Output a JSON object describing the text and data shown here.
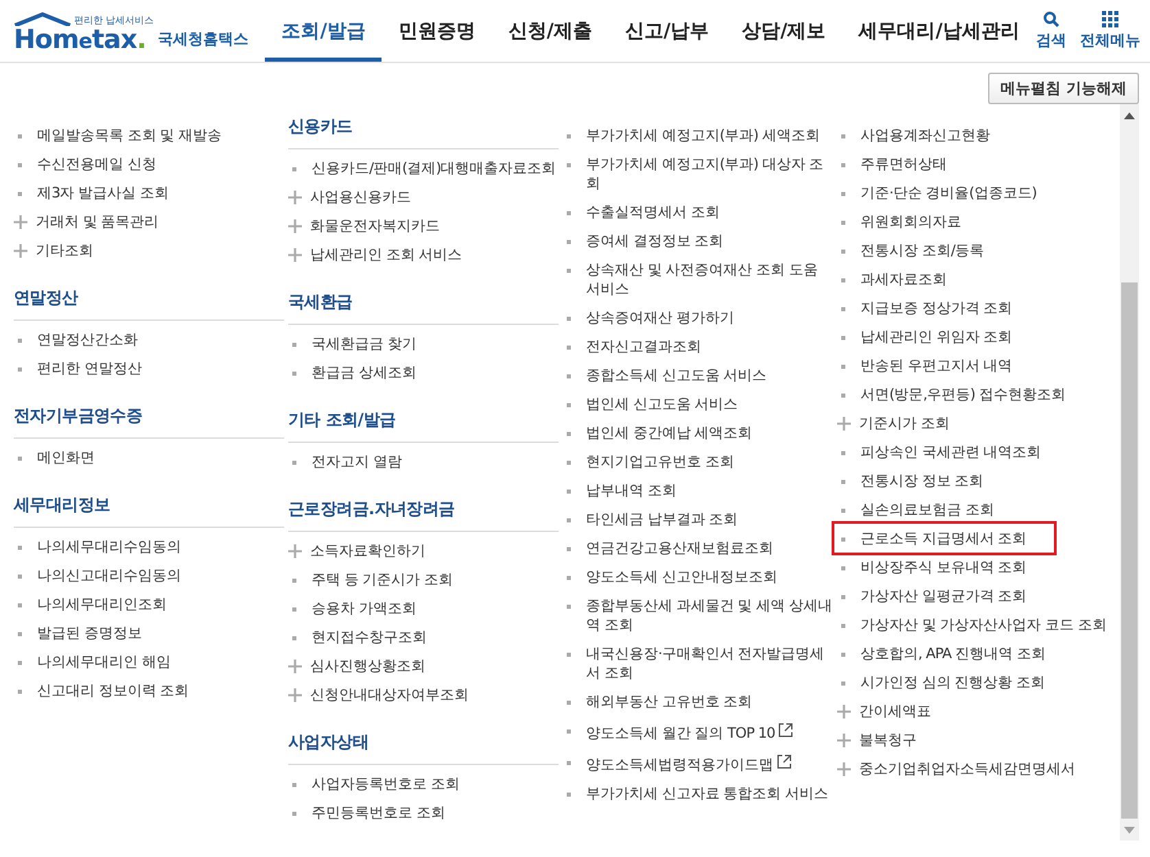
{
  "header": {
    "logo": {
      "tagline": "편리한 납세서비스",
      "name_start": "Hom",
      "name_mark": "e",
      "name_end": "tax",
      "dot": ".",
      "subtitle": "국세청홈택스"
    },
    "tabs": [
      {
        "label": "조회/발급",
        "selected": true
      },
      {
        "label": "민원증명",
        "selected": false
      },
      {
        "label": "신청/제출",
        "selected": false
      },
      {
        "label": "신고/납부",
        "selected": false
      },
      {
        "label": "상담/제보",
        "selected": false
      },
      {
        "label": "세무대리/납세관리",
        "selected": false
      }
    ],
    "actions": [
      {
        "kind": "search",
        "label": "검색"
      },
      {
        "kind": "menu",
        "label": "전체메뉴"
      }
    ]
  },
  "toggle_button": "메뉴펼침 기능해제",
  "columns": [
    {
      "sections": [
        {
          "items": [
            {
              "label": "메일발송목록 조회 및 재발송",
              "kind": "bullet",
              "highlighted": false
            },
            {
              "label": "수신전용메일 신청",
              "kind": "bullet",
              "highlighted": false
            },
            {
              "label": "제3자 발급사실 조회",
              "kind": "bullet",
              "highlighted": false
            },
            {
              "label": "거래처 및 품목관리",
              "kind": "plus",
              "highlighted": false
            },
            {
              "label": "기타조회",
              "kind": "plus",
              "highlighted": false
            }
          ]
        },
        {
          "heading": "연말정산",
          "items": [
            {
              "label": "연말정산간소화",
              "kind": "bullet",
              "highlighted": false
            },
            {
              "label": "편리한 연말정산",
              "kind": "bullet",
              "highlighted": false
            }
          ]
        },
        {
          "heading": "전자기부금영수증",
          "items": [
            {
              "label": "메인화면",
              "kind": "bullet",
              "highlighted": false
            }
          ]
        },
        {
          "heading": "세무대리정보",
          "items": [
            {
              "label": "나의세무대리수임동의",
              "kind": "bullet",
              "highlighted": false
            },
            {
              "label": "나의신고대리수임동의",
              "kind": "bullet",
              "highlighted": false
            },
            {
              "label": "나의세무대리인조회",
              "kind": "bullet",
              "highlighted": false
            },
            {
              "label": "발급된 증명정보",
              "kind": "bullet",
              "highlighted": false
            },
            {
              "label": "나의세무대리인 해임",
              "kind": "bullet",
              "highlighted": false
            },
            {
              "label": "신고대리 정보이력 조회",
              "kind": "bullet",
              "highlighted": false
            }
          ]
        }
      ]
    },
    {
      "sections": [
        {
          "heading": "신용카드",
          "items": [
            {
              "label": "신용카드/판매(결제)대행매출자료조회",
              "kind": "bullet",
              "highlighted": false
            },
            {
              "label": "사업용신용카드",
              "kind": "plus",
              "highlighted": false
            },
            {
              "label": "화물운전자복지카드",
              "kind": "plus",
              "highlighted": false
            },
            {
              "label": "납세관리인 조회 서비스",
              "kind": "plus",
              "highlighted": false
            }
          ]
        },
        {
          "heading": "국세환급",
          "items": [
            {
              "label": "국세환급금 찾기",
              "kind": "bullet",
              "highlighted": false
            },
            {
              "label": "환급금 상세조회",
              "kind": "bullet",
              "highlighted": false
            }
          ]
        },
        {
          "heading": "기타 조회/발급",
          "items": [
            {
              "label": "전자고지 열람",
              "kind": "bullet",
              "highlighted": false
            }
          ]
        },
        {
          "heading": "근로장려금.자녀장려금",
          "items": [
            {
              "label": "소득자료확인하기",
              "kind": "plus",
              "highlighted": false
            },
            {
              "label": "주택 등 기준시가 조회",
              "kind": "bullet",
              "highlighted": false
            },
            {
              "label": "승용차 가액조회",
              "kind": "bullet",
              "highlighted": false
            },
            {
              "label": "현지접수창구조회",
              "kind": "bullet",
              "highlighted": false
            },
            {
              "label": "심사진행상황조회",
              "kind": "plus",
              "highlighted": false
            },
            {
              "label": "신청안내대상자여부조회",
              "kind": "plus",
              "highlighted": false
            }
          ]
        },
        {
          "heading": "사업자상태",
          "items": [
            {
              "label": "사업자등록번호로 조회",
              "kind": "bullet",
              "highlighted": false
            },
            {
              "label": "주민등록번호로 조회",
              "kind": "bullet",
              "highlighted": false
            }
          ]
        }
      ]
    },
    {
      "sections": [
        {
          "items": [
            {
              "label": "부가가치세 예정고지(부과) 세액조회",
              "kind": "bullet",
              "highlighted": false
            },
            {
              "label": "부가가치세 예정고지(부과) 대상자 조회",
              "kind": "bullet",
              "highlighted": false
            },
            {
              "label": "수출실적명세서 조회",
              "kind": "bullet",
              "highlighted": false
            },
            {
              "label": "증여세 결정정보 조회",
              "kind": "bullet",
              "highlighted": false
            },
            {
              "label": "상속재산 및 사전증여재산 조회 도움 서비스",
              "kind": "bullet",
              "highlighted": false
            },
            {
              "label": "상속증여재산 평가하기",
              "kind": "bullet",
              "highlighted": false
            },
            {
              "label": "전자신고결과조회",
              "kind": "bullet",
              "highlighted": false
            },
            {
              "label": "종합소득세 신고도움 서비스",
              "kind": "bullet",
              "highlighted": false
            },
            {
              "label": "법인세 신고도움 서비스",
              "kind": "bullet",
              "highlighted": false
            },
            {
              "label": "법인세 중간예납 세액조회",
              "kind": "bullet",
              "highlighted": false
            },
            {
              "label": "현지기업고유번호 조회",
              "kind": "bullet",
              "highlighted": false
            },
            {
              "label": "납부내역 조회",
              "kind": "bullet",
              "highlighted": false
            },
            {
              "label": "타인세금 납부결과 조회",
              "kind": "bullet",
              "highlighted": false
            },
            {
              "label": "연금건강고용산재보험료조회",
              "kind": "bullet",
              "highlighted": false
            },
            {
              "label": "양도소득세 신고안내정보조회",
              "kind": "bullet",
              "highlighted": false
            },
            {
              "label": "종합부동산세 과세물건 및 세액 상세내역 조회",
              "kind": "bullet",
              "highlighted": false
            },
            {
              "label": "내국신용장·구매확인서 전자발급명세서 조회",
              "kind": "bullet",
              "highlighted": false
            },
            {
              "label": "해외부동산 고유번호 조회",
              "kind": "bullet",
              "highlighted": false
            },
            {
              "label": "양도소득세 월간 질의 TOP 10",
              "kind": "external",
              "highlighted": false
            },
            {
              "label": "양도소득세법령적용가이드맵",
              "kind": "external",
              "highlighted": false
            },
            {
              "label": "부가가치세 신고자료 통합조회 서비스",
              "kind": "bullet",
              "highlighted": false
            }
          ]
        }
      ]
    },
    {
      "sections": [
        {
          "items": [
            {
              "label": "사업용계좌신고현황",
              "kind": "bullet",
              "highlighted": false
            },
            {
              "label": "주류면허상태",
              "kind": "bullet",
              "highlighted": false
            },
            {
              "label": "기준·단순 경비율(업종코드)",
              "kind": "bullet",
              "highlighted": false
            },
            {
              "label": "위원회회의자료",
              "kind": "bullet",
              "highlighted": false
            },
            {
              "label": "전통시장 조회/등록",
              "kind": "bullet",
              "highlighted": false
            },
            {
              "label": "과세자료조회",
              "kind": "bullet",
              "highlighted": false
            },
            {
              "label": "지급보증 정상가격 조회",
              "kind": "bullet",
              "highlighted": false
            },
            {
              "label": "납세관리인 위임자 조회",
              "kind": "bullet",
              "highlighted": false
            },
            {
              "label": "반송된 우편고지서 내역",
              "kind": "bullet",
              "highlighted": false
            },
            {
              "label": "서면(방문,우편등) 접수현황조회",
              "kind": "bullet",
              "highlighted": false
            },
            {
              "label": "기준시가 조회",
              "kind": "plus",
              "highlighted": false
            },
            {
              "label": "피상속인 국세관련 내역조회",
              "kind": "bullet",
              "highlighted": false
            },
            {
              "label": "전통시장 정보 조회",
              "kind": "bullet",
              "highlighted": false
            },
            {
              "label": "실손의료보험금 조회",
              "kind": "bullet",
              "highlighted": false
            },
            {
              "label": "근로소득 지급명세서 조회",
              "kind": "bullet",
              "highlighted": true
            },
            {
              "label": "비상장주식 보유내역 조회",
              "kind": "bullet",
              "highlighted": false
            },
            {
              "label": "가상자산 일평균가격 조회",
              "kind": "bullet",
              "highlighted": false
            },
            {
              "label": "가상자산 및 가상자산사업자 코드 조회",
              "kind": "bullet",
              "highlighted": false
            },
            {
              "label": "상호합의, APA 진행내역 조회",
              "kind": "bullet",
              "highlighted": false
            },
            {
              "label": "시가인정 심의 진행상황 조회",
              "kind": "bullet",
              "highlighted": false
            },
            {
              "label": "간이세액표",
              "kind": "plus",
              "highlighted": false
            },
            {
              "label": "불복청구",
              "kind": "plus",
              "highlighted": false
            },
            {
              "label": "중소기업취업자소득세감면명세서",
              "kind": "plus",
              "highlighted": false
            }
          ]
        }
      ]
    }
  ]
}
